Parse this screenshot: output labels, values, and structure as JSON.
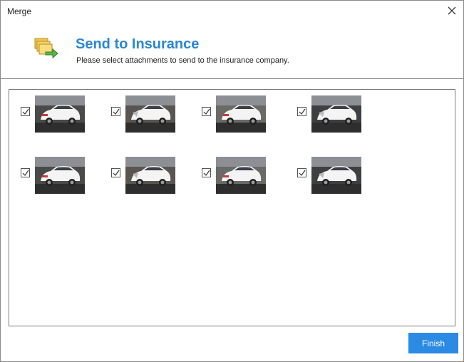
{
  "window": {
    "title": "Merge"
  },
  "header": {
    "icon": "send-folders-icon",
    "title": "Send to Insurance",
    "subtitle": "Please select attachments to send to the insurance company."
  },
  "attachments": [
    {
      "checked": true,
      "image": "car-photo-front-damaged"
    },
    {
      "checked": true,
      "image": "car-photo-front-left-damaged"
    },
    {
      "checked": true,
      "image": "car-photo-rear-angle"
    },
    {
      "checked": true,
      "image": "car-photo-rear"
    },
    {
      "checked": true,
      "image": "car-photo-rear-left"
    },
    {
      "checked": true,
      "image": "car-photo-front-left-damaged"
    },
    {
      "checked": true,
      "image": "car-photo-front-damaged"
    },
    {
      "checked": true,
      "image": "car-photo-front"
    }
  ],
  "footer": {
    "finish_label": "Finish"
  },
  "colors": {
    "accent": "#2b86d4",
    "button": "#2b8ae4"
  }
}
